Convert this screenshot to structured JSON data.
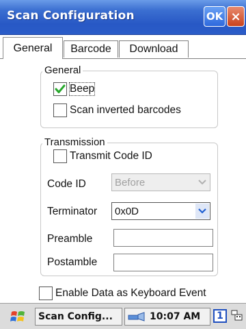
{
  "window": {
    "title": "Scan Configuration",
    "ok_label": "OK",
    "close_label": "×"
  },
  "tabs": [
    {
      "label": "General",
      "active": true
    },
    {
      "label": "Barcode",
      "active": false
    },
    {
      "label": "Download",
      "active": false
    }
  ],
  "general_group": {
    "legend": "General",
    "beep": {
      "label": "Beep",
      "checked": true
    },
    "scan_inverted": {
      "label": "Scan inverted barcodes",
      "checked": false
    }
  },
  "transmission_group": {
    "legend": "Transmission",
    "transmit_code_id": {
      "label": "Transmit Code ID",
      "checked": false
    },
    "code_id": {
      "label": "Code ID",
      "value": "Before",
      "disabled": true
    },
    "terminator": {
      "label": "Terminator",
      "value": "0x0D"
    },
    "preamble": {
      "label": "Preamble",
      "value": ""
    },
    "postamble": {
      "label": "Postamble",
      "value": ""
    }
  },
  "keyboard_event": {
    "label": "Enable Data as Keyboard Event",
    "checked": false
  },
  "taskbar": {
    "active_app": "Scan Config...",
    "time": "10:07 AM",
    "input_indicator": "1"
  },
  "colors": {
    "titlebar": "#2858c5",
    "checkmark": "#27a82c",
    "accent": "#1f5fd1"
  }
}
